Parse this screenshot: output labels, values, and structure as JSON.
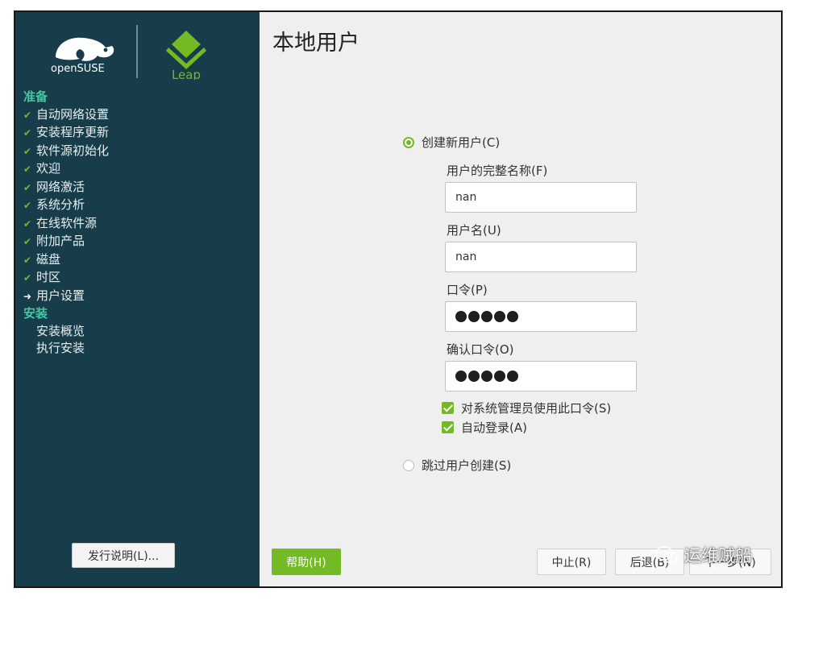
{
  "brand": {
    "opensuse_text": "openSUSE",
    "leap_text": "Leap"
  },
  "sidebar": {
    "sections": [
      {
        "heading": "准备",
        "items": [
          {
            "label": "自动网络设置",
            "state": "done"
          },
          {
            "label": "安装程序更新",
            "state": "done"
          },
          {
            "label": "软件源初始化",
            "state": "done"
          },
          {
            "label": "欢迎",
            "state": "done"
          },
          {
            "label": "网络激活",
            "state": "done"
          },
          {
            "label": "系统分析",
            "state": "done"
          },
          {
            "label": "在线软件源",
            "state": "done"
          },
          {
            "label": "附加产品",
            "state": "done"
          },
          {
            "label": "磁盘",
            "state": "done"
          },
          {
            "label": "时区",
            "state": "done"
          },
          {
            "label": "用户设置",
            "state": "current"
          }
        ]
      },
      {
        "heading": "安装",
        "items": [
          {
            "label": "安装概览",
            "state": "pending"
          },
          {
            "label": "执行安装",
            "state": "pending"
          }
        ]
      }
    ],
    "release_notes_button": "发行说明(L)..."
  },
  "page": {
    "title": "本地用户",
    "create_user_radio": "创建新用户(C)",
    "full_name_label": "用户的完整名称(F)",
    "full_name_value": "nan",
    "username_label": "用户名(U)",
    "username_value": "nan",
    "password_label": "口令(P)",
    "password_dots": 5,
    "confirm_password_label": "确认口令(O)",
    "confirm_password_dots": 5,
    "admin_checkbox": "对系统管理员使用此口令(S)",
    "admin_checked": true,
    "autologin_checkbox": "自动登录(A)",
    "autologin_checked": true,
    "skip_user_radio": "跳过用户创建(S)",
    "selected_option": "create"
  },
  "footer": {
    "help_button": "帮助(H)",
    "abort_button": "中止(R)",
    "back_button": "后退(B)",
    "next_button": "下一步(N)"
  },
  "watermark": {
    "text": "运维贼船"
  },
  "colors": {
    "sidebar_bg": "#173d4a",
    "accent_green": "#73ba25",
    "heading_teal": "#45c5a0",
    "main_bg": "#efefef"
  }
}
